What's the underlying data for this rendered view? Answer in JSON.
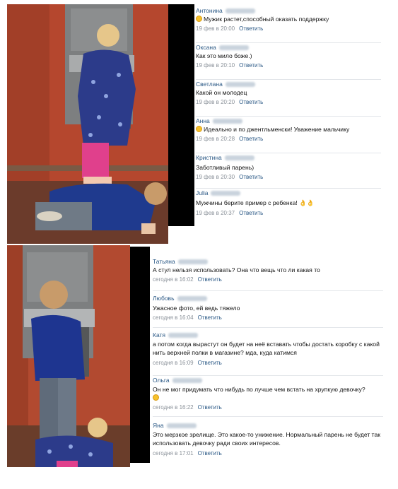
{
  "panel1": {
    "comments": [
      {
        "name": "Антонина",
        "emoji": true,
        "text": "Мужик растет,способный оказать поддержку",
        "date": "19 фев в 20:00",
        "reply": "Ответить"
      },
      {
        "name": "Оксана",
        "emoji": false,
        "text": "Как это мило боже.)",
        "date": "19 фев в 20:10",
        "reply": "Ответить"
      },
      {
        "name": "Светлана",
        "emoji": false,
        "text": "Какой он молодец",
        "date": "19 фев в 20:20",
        "reply": "Ответить"
      },
      {
        "name": "Анна",
        "emoji": true,
        "text": "Идеально и по джентльменски! Уважение мальчику",
        "date": "19 фев в 20:28",
        "reply": "Ответить"
      },
      {
        "name": "Кристина",
        "emoji": false,
        "text": "Заботливый парень)",
        "date": "19 фев в 20:30",
        "reply": "Ответить"
      },
      {
        "name": "Julia",
        "emoji": false,
        "text": "Мужчины берите пример с ребенка! 👌👌",
        "date": "19 фев в 20:37",
        "reply": "Ответить"
      }
    ]
  },
  "panel2": {
    "comments": [
      {
        "name": "Татьяна",
        "text": "А стул нельзя использовать? Она что вещь что ли какая то",
        "date": "сегодня в 16:02",
        "reply": "Ответить"
      },
      {
        "name": "Любовь",
        "text": "Ужасное фото, ей ведь тяжело",
        "date": "сегодня в 16:04",
        "reply": "Ответить"
      },
      {
        "name": "Катя",
        "text": "а потом когда вырастут он будет на неё вставать чтобы достать коробку с какой нить верхней полки в магазине? мда, куда катимся",
        "date": "сегодня в 16:09",
        "reply": "Ответить"
      },
      {
        "name": "Ольга",
        "text": "Он не мог придумать что нибудь по лучше чем встать на хрупкую девочку?",
        "emoji_line": true,
        "date": "сегодня в 16:22",
        "reply": "Ответить"
      },
      {
        "name": "Яна",
        "text": "Это мерзкое зрелище. Это какое-то унижение. Нормальный парень не будет так использовать девочку ради своих интересов.",
        "date": "сегодня в 17:01",
        "reply": "Ответить"
      }
    ]
  }
}
